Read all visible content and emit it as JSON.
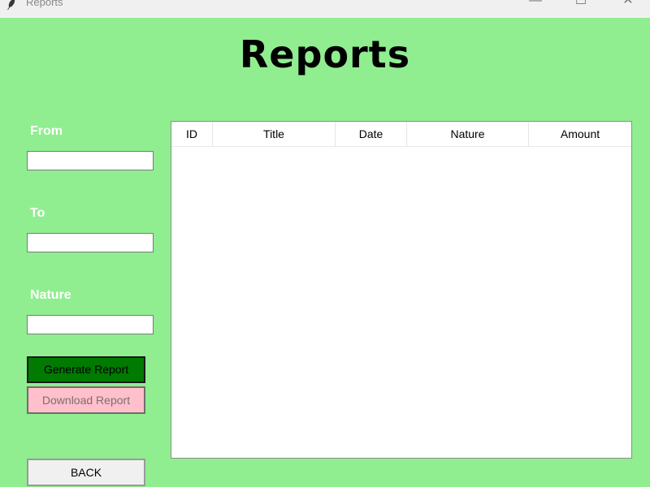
{
  "window": {
    "title": "Reports",
    "minimize_glyph": "—",
    "maximize_glyph": "☐",
    "close_glyph": "✕"
  },
  "page": {
    "title": "Reports"
  },
  "form": {
    "from_label": "From",
    "from_value": "",
    "to_label": "To",
    "to_value": "",
    "nature_label": "Nature",
    "nature_value": ""
  },
  "buttons": {
    "generate": "Generate Report",
    "download": "Download Report",
    "back": "BACK"
  },
  "table": {
    "columns": [
      "ID",
      "Title",
      "Date",
      "Nature",
      "Amount"
    ],
    "rows": []
  },
  "colors": {
    "background": "#90ee90",
    "generate_button": "#007a00",
    "download_button": "#ffc0cb",
    "back_button": "#f0f0f0",
    "label_text": "#ffffff"
  },
  "icons": {
    "app": "feather-icon"
  }
}
